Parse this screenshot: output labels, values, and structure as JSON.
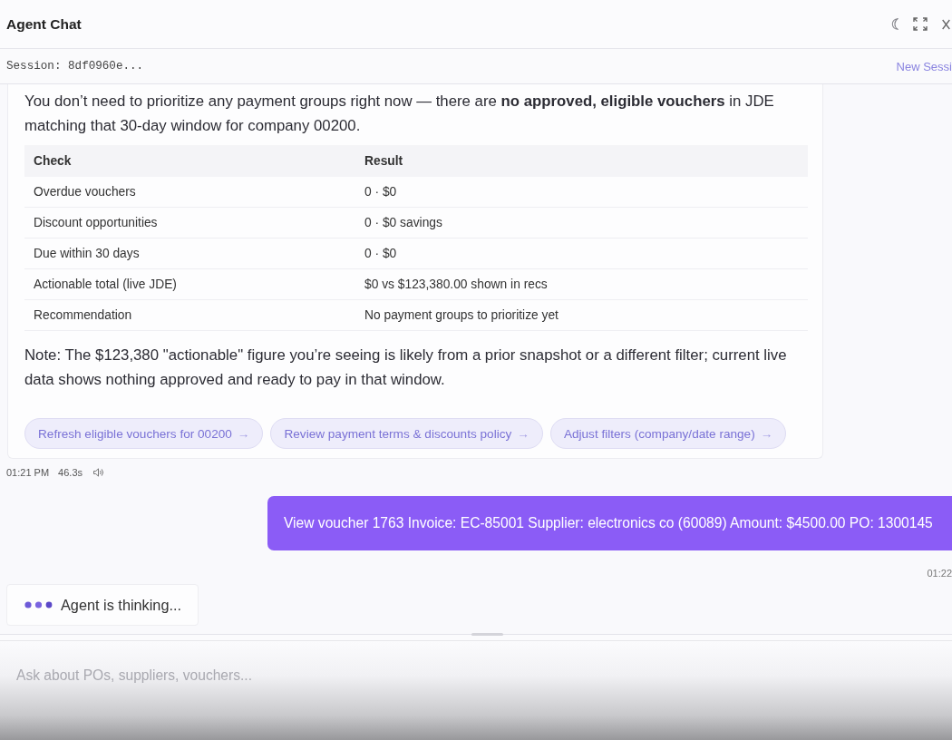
{
  "header": {
    "title": "Agent Chat"
  },
  "session": {
    "label": "Session: 8df0960e...",
    "new_session": "New Sessi"
  },
  "messages": [
    {
      "kind": "agent",
      "paragraph": "You don’t need to prioritize any payment groups right now — there are **no approved, eligible vouchers** in JDE matching that 30-day window for company 00200.",
      "table": {
        "columns": [
          "Check",
          "Result"
        ],
        "rows": [
          [
            "Overdue vouchers",
            "0 · $0"
          ],
          [
            "Discount opportunities",
            "0 · $0 savings"
          ],
          [
            "Due within 30 days",
            "0 · $0"
          ],
          [
            "Actionable total (live JDE)",
            "$0 vs $123,380.00 shown in recs"
          ],
          [
            "Recommendation",
            "No payment groups to prioritize yet"
          ]
        ]
      },
      "note": "Note: The $123,380 \"actionable\" figure you’re seeing is likely from a prior snapshot or a different filter; current live data shows nothing approved and ready to pay in that window.",
      "suggestions": [
        {
          "label": "Refresh eligible vouchers for 00200",
          "arrow": "→"
        },
        {
          "label": "Review payment terms & discounts policy",
          "arrow": "→"
        },
        {
          "label": "Adjust filters (company/date range)",
          "arrow": "→"
        }
      ],
      "time": "01:21 PM",
      "duration": "46.3s"
    },
    {
      "kind": "user",
      "text": "View voucher 1763 Invoice: EC-85001 Supplier: electronics co (60089) Amount: $4500.00 PO: 1300145",
      "time": "01:22"
    },
    {
      "kind": "thinking",
      "text": "Agent is thinking..."
    }
  ],
  "composer": {
    "placeholder": "Ask about POs, suppliers, vouchers..."
  }
}
